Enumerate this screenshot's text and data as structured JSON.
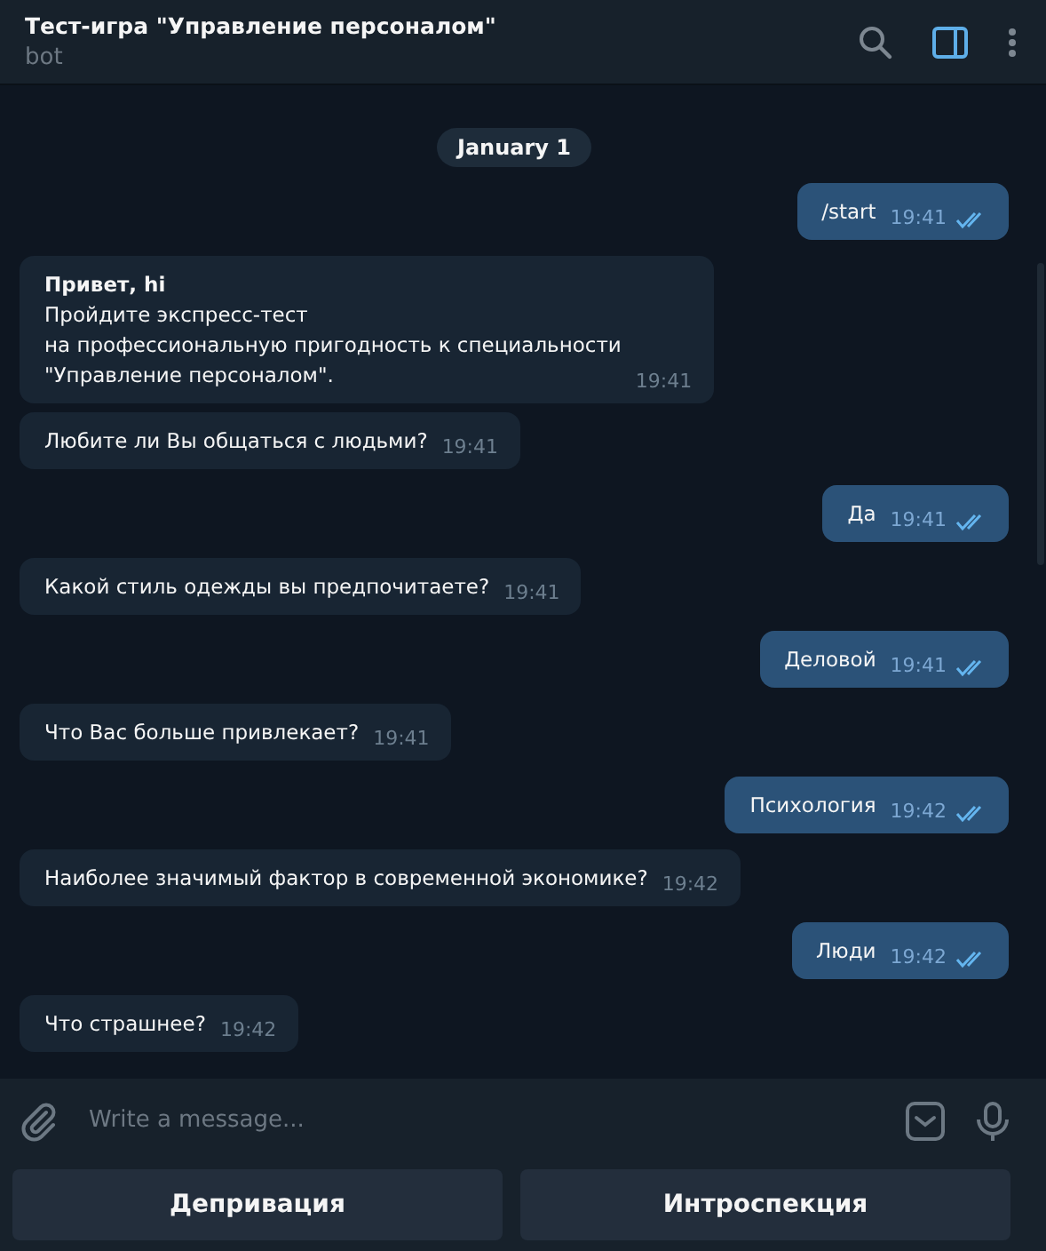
{
  "header": {
    "title": "Тест-игра \"Управление персоналом\"",
    "subtitle": "bot"
  },
  "date_badge": "January 1",
  "messages": [
    {
      "kind": "outgoing",
      "text": "/start",
      "time": "19:41",
      "read": true
    },
    {
      "kind": "incoming",
      "text": "**Привет, hi**\nПройдите экспресс-тест\nна профессиональную пригодность к специальности\n\"Управление персоналом\".",
      "time": "19:41"
    },
    {
      "kind": "incoming",
      "text": "Любите ли Вы общаться с людьми?",
      "time": "19:41"
    },
    {
      "kind": "outgoing",
      "text": "Да",
      "time": "19:41",
      "read": true
    },
    {
      "kind": "incoming",
      "text": "Какой стиль одежды вы предпочитаете?",
      "time": "19:41"
    },
    {
      "kind": "outgoing",
      "text": "Деловой",
      "time": "19:41",
      "read": true
    },
    {
      "kind": "incoming",
      "text": "Что Вас больше привлекает?",
      "time": "19:41"
    },
    {
      "kind": "outgoing",
      "text": "Психология",
      "time": "19:42",
      "read": true
    },
    {
      "kind": "incoming",
      "text": "Наиболее значимый фактор в современной экономике?",
      "time": "19:42"
    },
    {
      "kind": "outgoing",
      "text": "Люди",
      "time": "19:42",
      "read": true
    },
    {
      "kind": "incoming",
      "text": "Что страшнее?",
      "time": "19:42"
    }
  ],
  "composer": {
    "placeholder": "Write a message..."
  },
  "keyboard": [
    "Депривация",
    "Интроспекция"
  ]
}
